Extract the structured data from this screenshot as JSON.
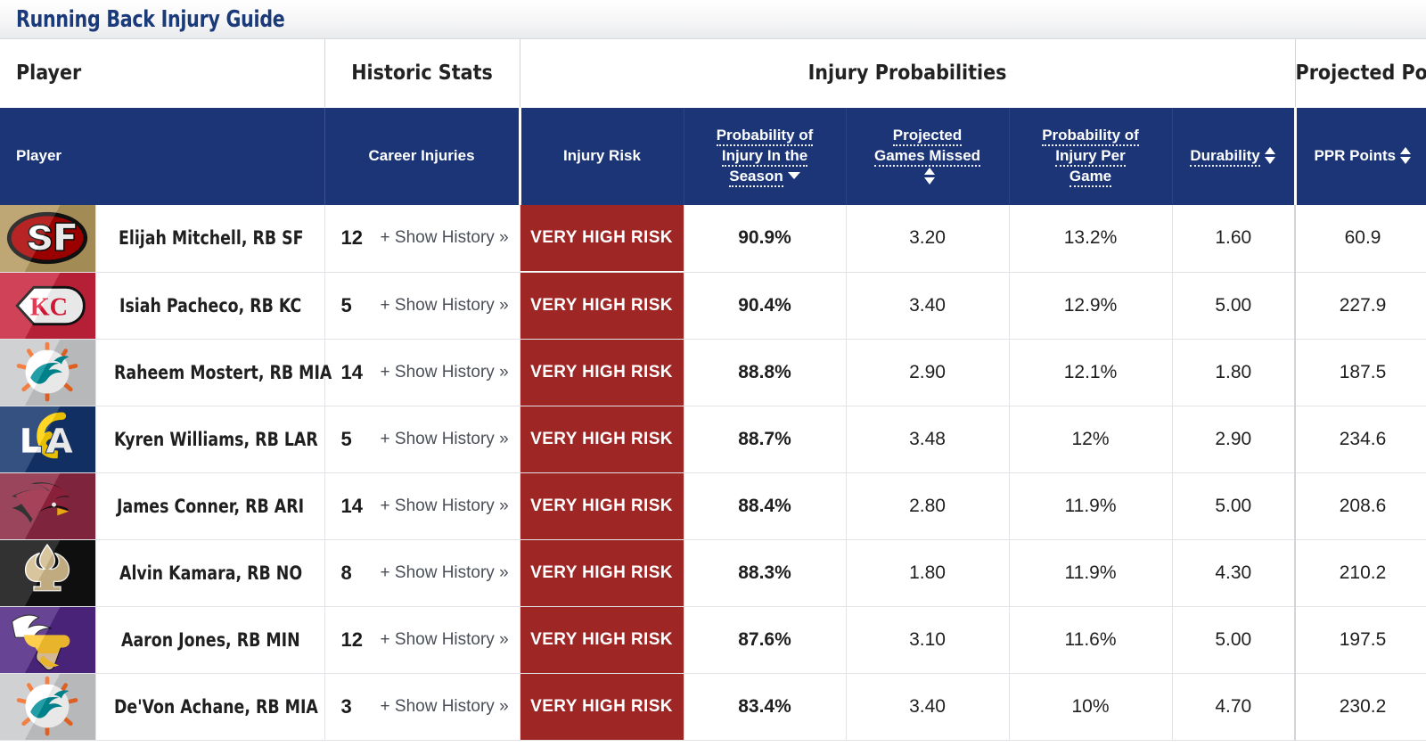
{
  "header": {
    "title": "Running Back Injury Guide"
  },
  "group_headers": [
    {
      "label": "Player",
      "key": "player"
    },
    {
      "label": "Historic Stats",
      "key": "historic"
    },
    {
      "label": "Injury Probabilities",
      "key": "probs"
    },
    {
      "label": "Projected Points",
      "key": "points"
    }
  ],
  "columns": [
    {
      "key": "player",
      "label": "Player",
      "tooltip": false,
      "sort": "none"
    },
    {
      "key": "career",
      "label": "Career Injuries",
      "tooltip": false,
      "sort": "none"
    },
    {
      "key": "risk",
      "label": "Injury Risk",
      "tooltip": false,
      "sort": "none"
    },
    {
      "key": "prob_season",
      "label_lines": [
        "Probability of",
        "Injury In the",
        "Season"
      ],
      "tooltip": true,
      "sort": "desc"
    },
    {
      "key": "games",
      "label_lines": [
        "Projected",
        "Games Missed"
      ],
      "tooltip": true,
      "sort": "both"
    },
    {
      "key": "prob_game",
      "label_lines": [
        "Probability of",
        "Injury Per",
        "Game"
      ],
      "tooltip": true,
      "sort": "none"
    },
    {
      "key": "durability",
      "label": "Durability",
      "tooltip": true,
      "sort": "both"
    },
    {
      "key": "ppr",
      "label": "PPR Points",
      "tooltip": false,
      "sort": "both"
    }
  ],
  "labels": {
    "show_history": "+ Show History »"
  },
  "colors": {
    "header_blue": "#1b3576",
    "title_blue": "#1b3a7a",
    "risk_red": "#9e2725",
    "prob_red": "#9b2321",
    "career_bg": "#e4e6ea"
  },
  "rows": [
    {
      "team": "SF",
      "team_name": "San Francisco 49ers",
      "logo": "sf-49ers-logo",
      "logo_bg": "#b3995d",
      "logo_fg": "#aa0000",
      "player": "Elijah Mitchell, RB SF",
      "career_injuries": "12",
      "risk": "VERY HIGH RISK",
      "prob_season": "90.9%",
      "games_missed": "3.20",
      "prob_game": "13.2%",
      "durability": "1.60",
      "ppr_points": "60.9"
    },
    {
      "team": "KC",
      "team_name": "Kansas City Chiefs",
      "logo": "kc-chiefs-logo",
      "logo_bg": "#c8233c",
      "logo_fg": "#e31837",
      "player": "Isiah Pacheco, RB KC",
      "career_injuries": "5",
      "risk": "VERY HIGH RISK",
      "prob_season": "90.4%",
      "games_missed": "3.40",
      "prob_game": "12.9%",
      "durability": "5.00",
      "ppr_points": "227.9"
    },
    {
      "team": "MIA",
      "team_name": "Miami Dolphins",
      "logo": "mia-dolphins-logo",
      "logo_bg": "#c9cacc",
      "logo_fg": "#008e97",
      "player": "Raheem Mostert, RB MIA",
      "career_injuries": "14",
      "risk": "VERY HIGH RISK",
      "prob_season": "88.8%",
      "games_missed": "2.90",
      "prob_game": "12.1%",
      "durability": "1.80",
      "ppr_points": "187.5"
    },
    {
      "team": "LAR",
      "team_name": "Los Angeles Rams",
      "logo": "lar-rams-logo",
      "logo_bg": "#13346b",
      "logo_fg": "#ffd100",
      "player": "Kyren Williams, RB LAR",
      "career_injuries": "5",
      "risk": "VERY HIGH RISK",
      "prob_season": "88.7%",
      "games_missed": "3.48",
      "prob_game": "12%",
      "durability": "2.90",
      "ppr_points": "234.6"
    },
    {
      "team": "ARI",
      "team_name": "Arizona Cardinals",
      "logo": "ari-cardinals-logo",
      "logo_bg": "#8b2742",
      "logo_fg": "#97233f",
      "player": "James Conner, RB ARI",
      "career_injuries": "14",
      "risk": "VERY HIGH RISK",
      "prob_season": "88.4%",
      "games_missed": "2.80",
      "prob_game": "11.9%",
      "durability": "5.00",
      "ppr_points": "208.6"
    },
    {
      "team": "NO",
      "team_name": "New Orleans Saints",
      "logo": "no-saints-logo",
      "logo_bg": "#101010",
      "logo_fg": "#d3bc8d",
      "player": "Alvin Kamara, RB NO",
      "career_injuries": "8",
      "risk": "VERY HIGH RISK",
      "prob_season": "88.3%",
      "games_missed": "1.80",
      "prob_game": "11.9%",
      "durability": "4.30",
      "ppr_points": "210.2"
    },
    {
      "team": "MIN",
      "team_name": "Minnesota Vikings",
      "logo": "min-vikings-logo",
      "logo_bg": "#4f2683",
      "logo_fg": "#ffc62f",
      "player": "Aaron Jones, RB MIN",
      "career_injuries": "12",
      "risk": "VERY HIGH RISK",
      "prob_season": "87.6%",
      "games_missed": "3.10",
      "prob_game": "11.6%",
      "durability": "5.00",
      "ppr_points": "197.5"
    },
    {
      "team": "MIA",
      "team_name": "Miami Dolphins",
      "logo": "mia-dolphins-logo",
      "logo_bg": "#c9cacc",
      "logo_fg": "#008e97",
      "player": "De'Von Achane, RB MIA",
      "career_injuries": "3",
      "risk": "VERY HIGH RISK",
      "prob_season": "83.4%",
      "games_missed": "3.40",
      "prob_game": "10%",
      "durability": "4.70",
      "ppr_points": "230.2"
    }
  ]
}
